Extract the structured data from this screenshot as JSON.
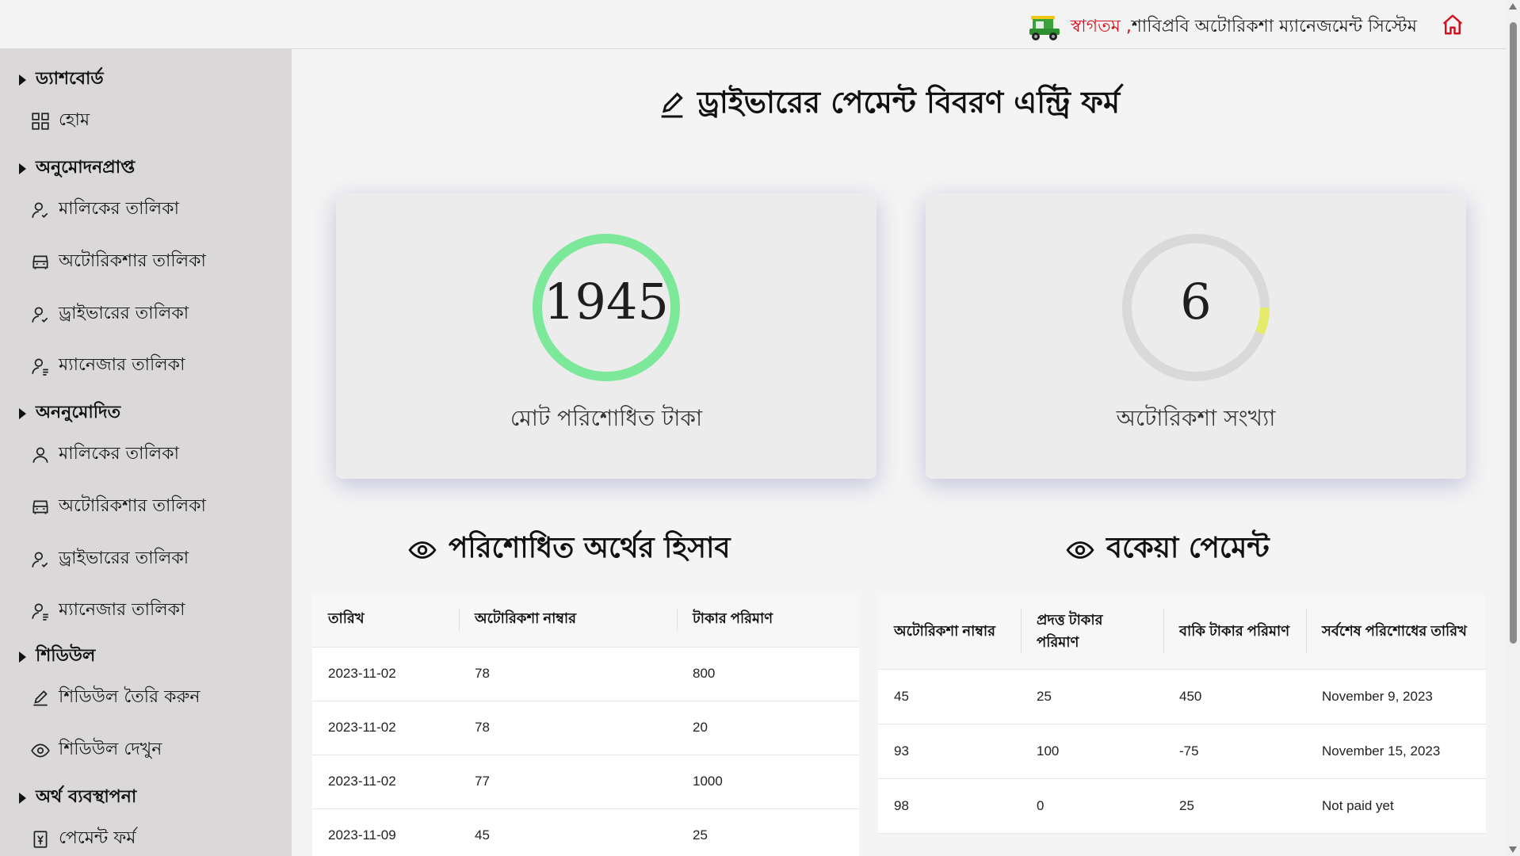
{
  "header": {
    "welcome_highlight": "স্বাগতম ,",
    "welcome_text": " শাবিপ্রবি অটোরিকশা ম্যানেজমেন্ট সিস্টেম",
    "accent_color": "#d40f1e",
    "icons": [
      "rickshaw-icon",
      "home-icon"
    ]
  },
  "sidebar": {
    "sections": [
      {
        "label": "ড্যাশবোর্ড",
        "items": [
          {
            "label": "হোম",
            "icon": "grid-icon"
          }
        ]
      },
      {
        "label": "অনুমোদনপ্রাপ্ত",
        "items": [
          {
            "label": "মালিকের তালিকা",
            "icon": "user-check-icon"
          },
          {
            "label": "অটোরিকশার তালিকা",
            "icon": "vehicle-icon"
          },
          {
            "label": "ড্রাইভারের তালিকা",
            "icon": "user-check-icon"
          },
          {
            "label": "ম্যানেজার তালিকা",
            "icon": "user-list-icon"
          }
        ]
      },
      {
        "label": "অননুমোদিত",
        "items": [
          {
            "label": "মালিকের তালিকা",
            "icon": "user-icon"
          },
          {
            "label": "অটোরিকশার তালিকা",
            "icon": "vehicle-icon"
          },
          {
            "label": "ড্রাইভারের তালিকা",
            "icon": "user-check-icon"
          },
          {
            "label": "ম্যানেজার তালিকা",
            "icon": "user-list-icon"
          }
        ]
      },
      {
        "label": "শিডিউল",
        "items": [
          {
            "label": "শিডিউল তৈরি করুন",
            "icon": "pencil-icon"
          },
          {
            "label": "শিডিউল দেখুন",
            "icon": "eye-icon"
          }
        ]
      },
      {
        "label": "অর্থ ব্যবস্থাপনা",
        "items": [
          {
            "label": "পেমেন্ট ফর্ম",
            "icon": "payment-form-icon"
          }
        ]
      }
    ]
  },
  "main": {
    "title": "ড্রাইভারের পেমেন্ট বিবরণ এন্ট্রি ফর্ম",
    "stats": [
      {
        "value": "1945",
        "label": "মোট পরিশোধিত টাকা",
        "progress": 1.0,
        "color": "#7ce89a"
      },
      {
        "value": "6",
        "label": "অটোরিকশা সংখ্যা",
        "progress": 0.06,
        "color": "#e4ec6a"
      }
    ],
    "paid_section": {
      "title": "পরিশোধিত অর্থের হিসাব",
      "columns": [
        "তারিখ",
        "অটোরিকশা নাম্বার",
        "টাকার পরিমাণ"
      ],
      "rows": [
        [
          "2023-11-02",
          "78",
          "800"
        ],
        [
          "2023-11-02",
          "78",
          "20"
        ],
        [
          "2023-11-02",
          "77",
          "1000"
        ],
        [
          "2023-11-09",
          "45",
          "25"
        ]
      ]
    },
    "due_section": {
      "title": "বকেয়া পেমেন্ট",
      "columns": [
        "অটোরিকশা নাম্বার",
        "প্রদত্ত টাকার পরিমাণ",
        "বাকি টাকার পরিমাণ",
        "সর্বশেষ পরিশোধের তারিখ"
      ],
      "rows": [
        [
          "45",
          "25",
          "450",
          "November 9, 2023"
        ],
        [
          "93",
          "100",
          "-75",
          "November 15, 2023"
        ],
        [
          "98",
          "0",
          "25",
          "Not paid yet"
        ]
      ]
    }
  }
}
